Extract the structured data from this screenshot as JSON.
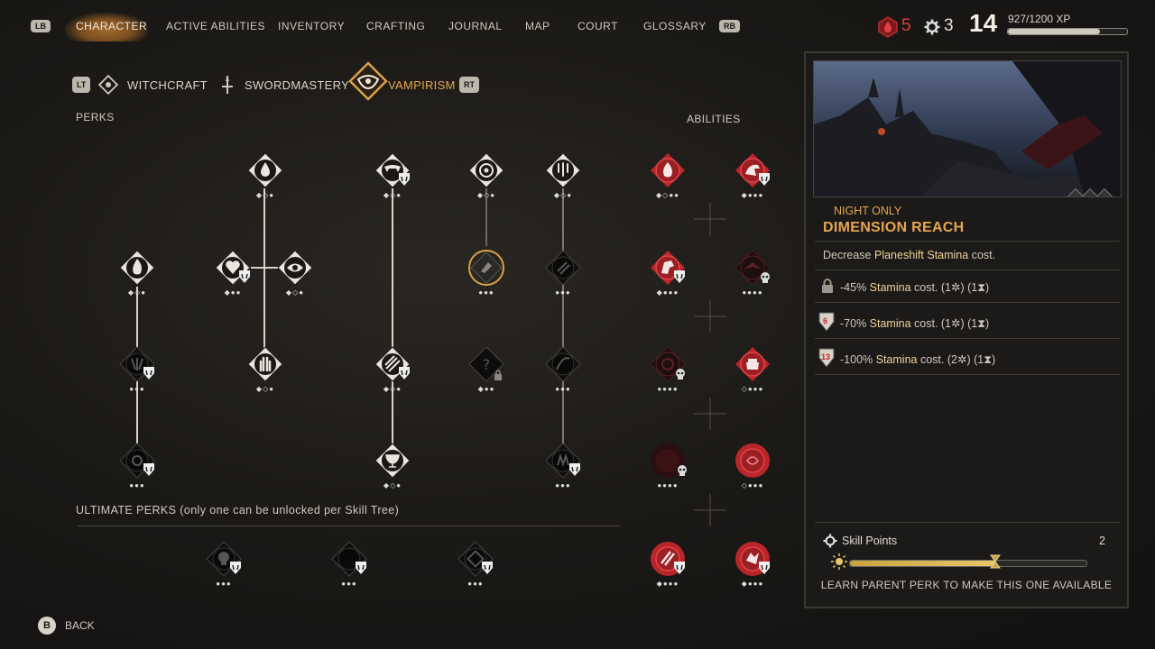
{
  "nav": {
    "lb": "LB",
    "rb": "RB",
    "tabs": [
      "CHARACTER",
      "ACTIVE ABILITIES",
      "INVENTORY",
      "CRAFTING",
      "JOURNAL",
      "MAP",
      "COURT",
      "GLOSSARY"
    ],
    "active_tab": "CHARACTER"
  },
  "stats": {
    "blood_count": "5",
    "skill_count": "3",
    "level": "14",
    "xp_text": "927/1200 XP",
    "xp_fraction": 0.7725
  },
  "trees": {
    "lt": "LT",
    "rt": "RT",
    "tabs": [
      "WITCHCRAFT",
      "SWORDMASTERY",
      "VAMPIRISM"
    ],
    "active": "VAMPIRISM"
  },
  "sections": {
    "perks": "PERKS",
    "abilities": "ABILITIES",
    "ultimate": "ULTIMATE PERKS (only one can be unlocked per Skill Tree)"
  },
  "pips": {
    "p1": "◆◇●",
    "p2": "◆●●",
    "p3": "●●●",
    "p4": "◆◇●●",
    "p5": "◇●●●",
    "p6": "●●●●",
    "p7": "◆●●●"
  },
  "detail": {
    "tag": "NIGHT ONLY",
    "title": "DIMENSION REACH",
    "desc_prefix": "Decrease ",
    "desc_key": "Planeshift Stamina",
    "desc_suffix": " cost.",
    "ranks": [
      {
        "badge": "",
        "pct": "-45%",
        "stat": "Stamina",
        "cost_word": " cost.",
        "sp": "(1",
        "time": ") (1",
        "end": ")"
      },
      {
        "badge": "6",
        "pct": "-70%",
        "stat": "Stamina",
        "cost_word": " cost.",
        "sp": "(1",
        "time": ") (1",
        "end": ")"
      },
      {
        "badge": "13",
        "pct": "-100%",
        "stat": "Stamina",
        "cost_word": " cost.",
        "sp": "(2",
        "time": ") (1",
        "end": ")"
      }
    ],
    "skill_points_label": "Skill Points",
    "skill_points_value": "2",
    "day_cycle_fraction": 0.62,
    "footer": "LEARN PARENT PERK TO MAKE THIS ONE AVAILABLE"
  },
  "bottom": {
    "b": "B",
    "back": "BACK"
  },
  "colors": {
    "accent": "#d9a14a",
    "blood": "#c0282b",
    "gold_text": "#f1d39a"
  }
}
